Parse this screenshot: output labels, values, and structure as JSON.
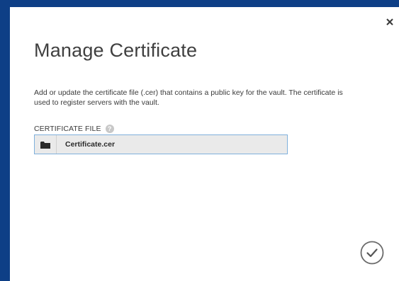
{
  "dialog": {
    "title": "Manage Certificate",
    "description": "Add or update the certificate file (.cer) that contains a public key for the vault. The certificate is used to register servers with the vault.",
    "field": {
      "label": "CERTIFICATE FILE",
      "help_glyph": "?",
      "value": "Certificate.cer",
      "browse_icon": "folder-icon"
    },
    "close_icon": "close-icon",
    "ok_icon": "checkmark-icon"
  },
  "colors": {
    "background": "#0e3f86",
    "dialog": "#ffffff",
    "input_border": "#7fb0dc",
    "input_background": "#eaeaea"
  }
}
